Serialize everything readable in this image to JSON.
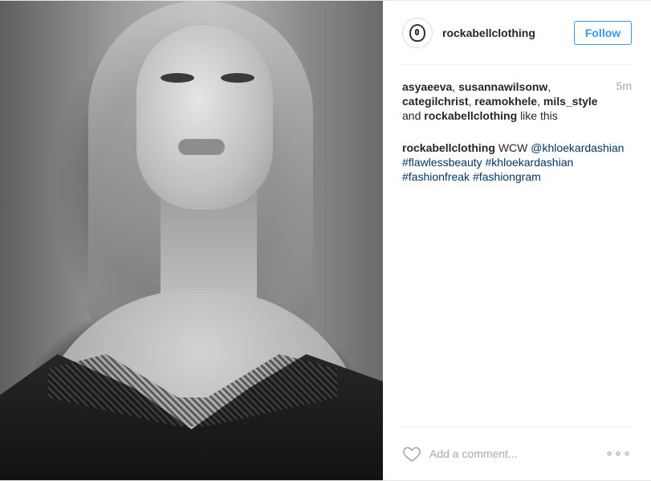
{
  "post": {
    "username": "rockabellclothing",
    "follow_label": "Follow",
    "time": "5m",
    "likes": {
      "users": [
        "asyaeeva",
        "susannawilsonw",
        "categilchrist",
        "reamokhele",
        "mils_style",
        "rockabellclothing"
      ],
      "and_text": "and",
      "suffix": "like this"
    },
    "caption": {
      "author": "rockabellclothing",
      "text": "WCW",
      "mention": "@khloekardashian",
      "hashtags": [
        "#flawlessbeauty",
        "#khloekardashian",
        "#fashionfreak",
        "#fashiongram"
      ]
    },
    "comment_placeholder": "Add a comment...",
    "more_label": "∘∘∘"
  },
  "icons": {
    "avatar": "rockabell-logo-icon",
    "like": "heart-icon",
    "more": "more-options-icon"
  },
  "colors": {
    "accent": "#3897f0",
    "hashtag": "#003569",
    "muted": "#a5a7aa"
  }
}
